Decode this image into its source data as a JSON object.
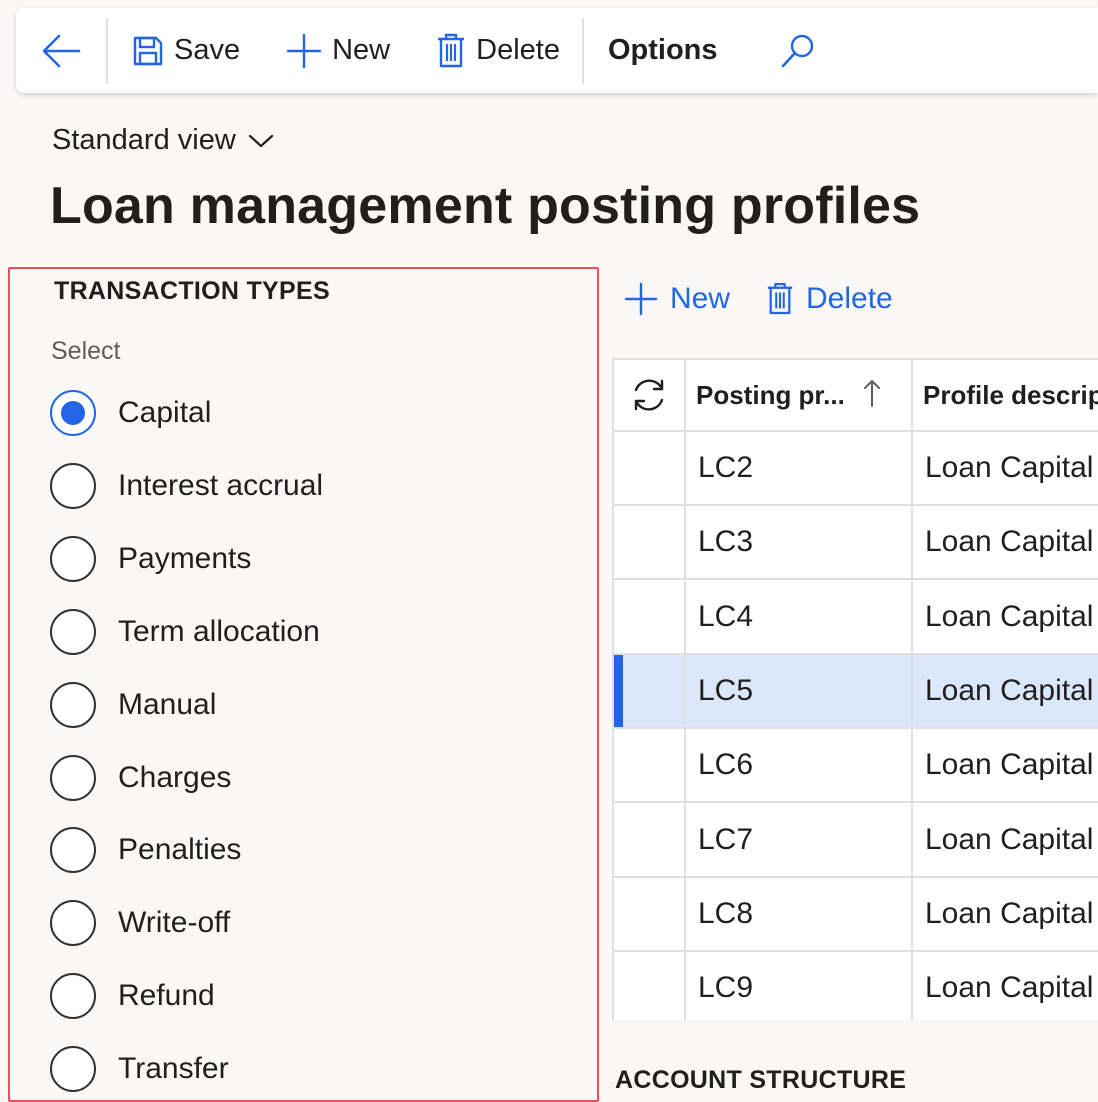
{
  "toolbar": {
    "back_icon": "back-arrow-icon",
    "save_label": "Save",
    "new_label": "New",
    "delete_label": "Delete",
    "options_label": "Options",
    "search_icon": "search-icon"
  },
  "view": {
    "label": "Standard view"
  },
  "page": {
    "title": "Loan management posting profiles"
  },
  "transaction_types": {
    "title": "TRANSACTION TYPES",
    "select_label": "Select",
    "options": [
      {
        "label": "Capital",
        "checked": true
      },
      {
        "label": "Interest accrual",
        "checked": false
      },
      {
        "label": "Payments",
        "checked": false
      },
      {
        "label": "Term allocation",
        "checked": false
      },
      {
        "label": "Manual",
        "checked": false
      },
      {
        "label": "Charges",
        "checked": false
      },
      {
        "label": "Penalties",
        "checked": false
      },
      {
        "label": "Write-off",
        "checked": false
      },
      {
        "label": "Refund",
        "checked": false
      },
      {
        "label": "Transfer",
        "checked": false
      }
    ]
  },
  "grid_actions": {
    "new_label": "New",
    "delete_label": "Delete"
  },
  "grid": {
    "columns": [
      "Posting pr...",
      "Profile descript"
    ],
    "rows": [
      {
        "code": "LC2",
        "description": "Loan Capital",
        "selected": false
      },
      {
        "code": "LC3",
        "description": "Loan Capital",
        "selected": false
      },
      {
        "code": "LC4",
        "description": "Loan Capital",
        "selected": false
      },
      {
        "code": "LC5",
        "description": "Loan Capital",
        "selected": true
      },
      {
        "code": "LC6",
        "description": "Loan Capital",
        "selected": false
      },
      {
        "code": "LC7",
        "description": "Loan Capital",
        "selected": false
      },
      {
        "code": "LC8",
        "description": "Loan Capital",
        "selected": false
      },
      {
        "code": "LC9",
        "description": "Loan Capital",
        "selected": false
      }
    ]
  },
  "account_structure": {
    "title": "ACCOUNT STRUCTURE"
  },
  "colors": {
    "accent": "#2266e3",
    "selected_row": "#dbe7fb",
    "highlight_border": "#e8505b"
  }
}
